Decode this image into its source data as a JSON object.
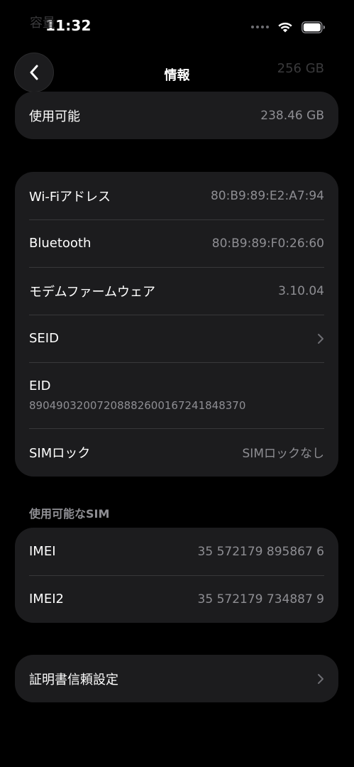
{
  "status_bar": {
    "time": "11:32",
    "icons": [
      "cellular-dots-icon",
      "wifi-icon",
      "battery-icon"
    ]
  },
  "nav": {
    "title": "情報",
    "back_icon": "chevron-left-icon"
  },
  "ghost_row": {
    "label": "容量",
    "value": "256 GB"
  },
  "storage_card": {
    "rows": [
      {
        "label": "使用可能",
        "value": "238.46 GB"
      }
    ]
  },
  "network_card": {
    "rows": [
      {
        "label": "Wi-Fiアドレス",
        "value": "80:B9:89:E2:A7:94"
      },
      {
        "label": "Bluetooth",
        "value": "80:B9:89:F0:26:60"
      },
      {
        "label": "モデムファームウェア",
        "value": "3.10.04"
      },
      {
        "label": "SEID",
        "value": ""
      },
      {
        "label": "EID",
        "value": "89049032007208882600167241848370"
      },
      {
        "label": "SIMロック",
        "value": "SIMロックなし"
      }
    ]
  },
  "sim_section": {
    "header": "使用可能なSIM",
    "rows": [
      {
        "label": "IMEI",
        "value": "35 572179 895867 6"
      },
      {
        "label": "IMEI2",
        "value": "35 572179 734887 9"
      }
    ]
  },
  "cert_card": {
    "rows": [
      {
        "label": "証明書信頼設定",
        "value": ""
      }
    ]
  },
  "colors": {
    "background": "#000000",
    "card": "#1c1c1e",
    "separator": "#38383a",
    "secondary_text": "#8e8e93"
  }
}
